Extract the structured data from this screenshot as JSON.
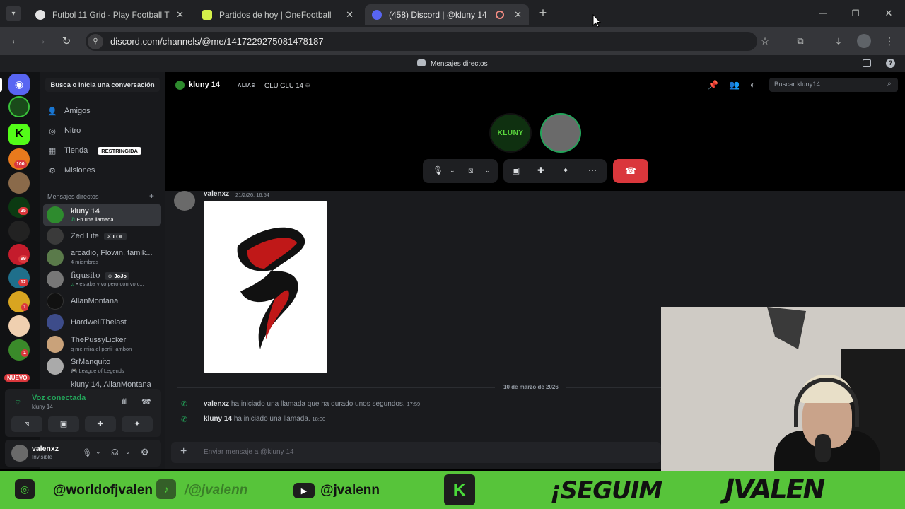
{
  "browser": {
    "tabs": [
      {
        "title": "Futbol 11 Grid - Play Football T",
        "close": "✕"
      },
      {
        "title": "Partidos de hoy | OneFootball",
        "close": "✕"
      },
      {
        "title": "(458) Discord | @kluny 14",
        "close": "✕"
      }
    ],
    "new_tab": "+",
    "url": "discord.com/channels/@me/1417229275081478187",
    "window": {
      "minimize": "—",
      "restore": "❐",
      "close": "✕"
    }
  },
  "discord": {
    "top_label": "Mensajes directos",
    "search_convo": "Busca o inicia una conversación",
    "nav": [
      {
        "label": "Amigos"
      },
      {
        "label": "Nitro"
      },
      {
        "label": "Tienda",
        "badge": "RESTRINGIDA"
      },
      {
        "label": "Misiones"
      }
    ],
    "dm_header": "Mensajes directos",
    "dm_add": "+",
    "dms": [
      {
        "name": "kluny 14",
        "sub": "En una llamada",
        "active": true,
        "color": "#2e8b2e"
      },
      {
        "name": "Zed Life",
        "tag": "LOL",
        "sub": "",
        "color": "#3a3a3a"
      },
      {
        "name": "arcadio, Flowin, tamik...",
        "sub": "4 miembros",
        "color": "#5a7a4a"
      },
      {
        "name": "figusito",
        "tag": "JoJo",
        "sub": "• estaba vivo pero con vo c...",
        "color": "#777"
      },
      {
        "name": "AllanMontana",
        "sub": "",
        "color": "#111"
      },
      {
        "name": "HardwellThelast",
        "sub": "",
        "color": "#3d4c8a"
      },
      {
        "name": "ThePussyLicker",
        "sub": "q me mira el perfil lambon",
        "color": "#c9a27a"
      },
      {
        "name": "SrManquito",
        "sub": "League of Legends",
        "color": "#aaa"
      },
      {
        "name": "kluny 14, AllanMontana",
        "sub": "",
        "color": "#2e8b2e"
      }
    ],
    "guild_badges": [
      "100",
      "25",
      "99",
      "12",
      "1",
      "1"
    ],
    "guild_new": "NUEVO",
    "voice": {
      "status": "Voz conectada",
      "channel": "kluny 14"
    },
    "user": {
      "name": "valenxz",
      "status": "Invisible"
    },
    "channel": {
      "name": "kluny 14",
      "alias_label": "ALIAS",
      "alias": "GLU GLU 14 ⯐",
      "search_placeholder": "Buscar kluny14"
    },
    "messages": [
      {
        "author": "valenxz",
        "time": "21/2/26, 16:54"
      }
    ],
    "date_divider": "10 de marzo de 2026",
    "system": [
      {
        "author": "valenxz",
        "text": "ha iniciado una llamada que ha durado unos segundos.",
        "time": "17:59"
      },
      {
        "author": "kluny 14",
        "text": "ha iniciado una llamada.",
        "time": "18:00"
      }
    ],
    "composer_placeholder": "Enviar mensaje a @kluny 14",
    "call_avatar_text": "KLUNY"
  },
  "overlay": {
    "items": [
      {
        "text": "@worldofjvalen"
      },
      {
        "text": "/@jvalenn"
      },
      {
        "text": "@jvalenn"
      },
      {
        "text": "¡SEGUIM"
      },
      {
        "text": "JVALEN"
      }
    ]
  },
  "colors": {
    "accent": "#5865f2",
    "green": "#23a55a",
    "red": "#da373c",
    "overlay_green": "#57c43a"
  }
}
